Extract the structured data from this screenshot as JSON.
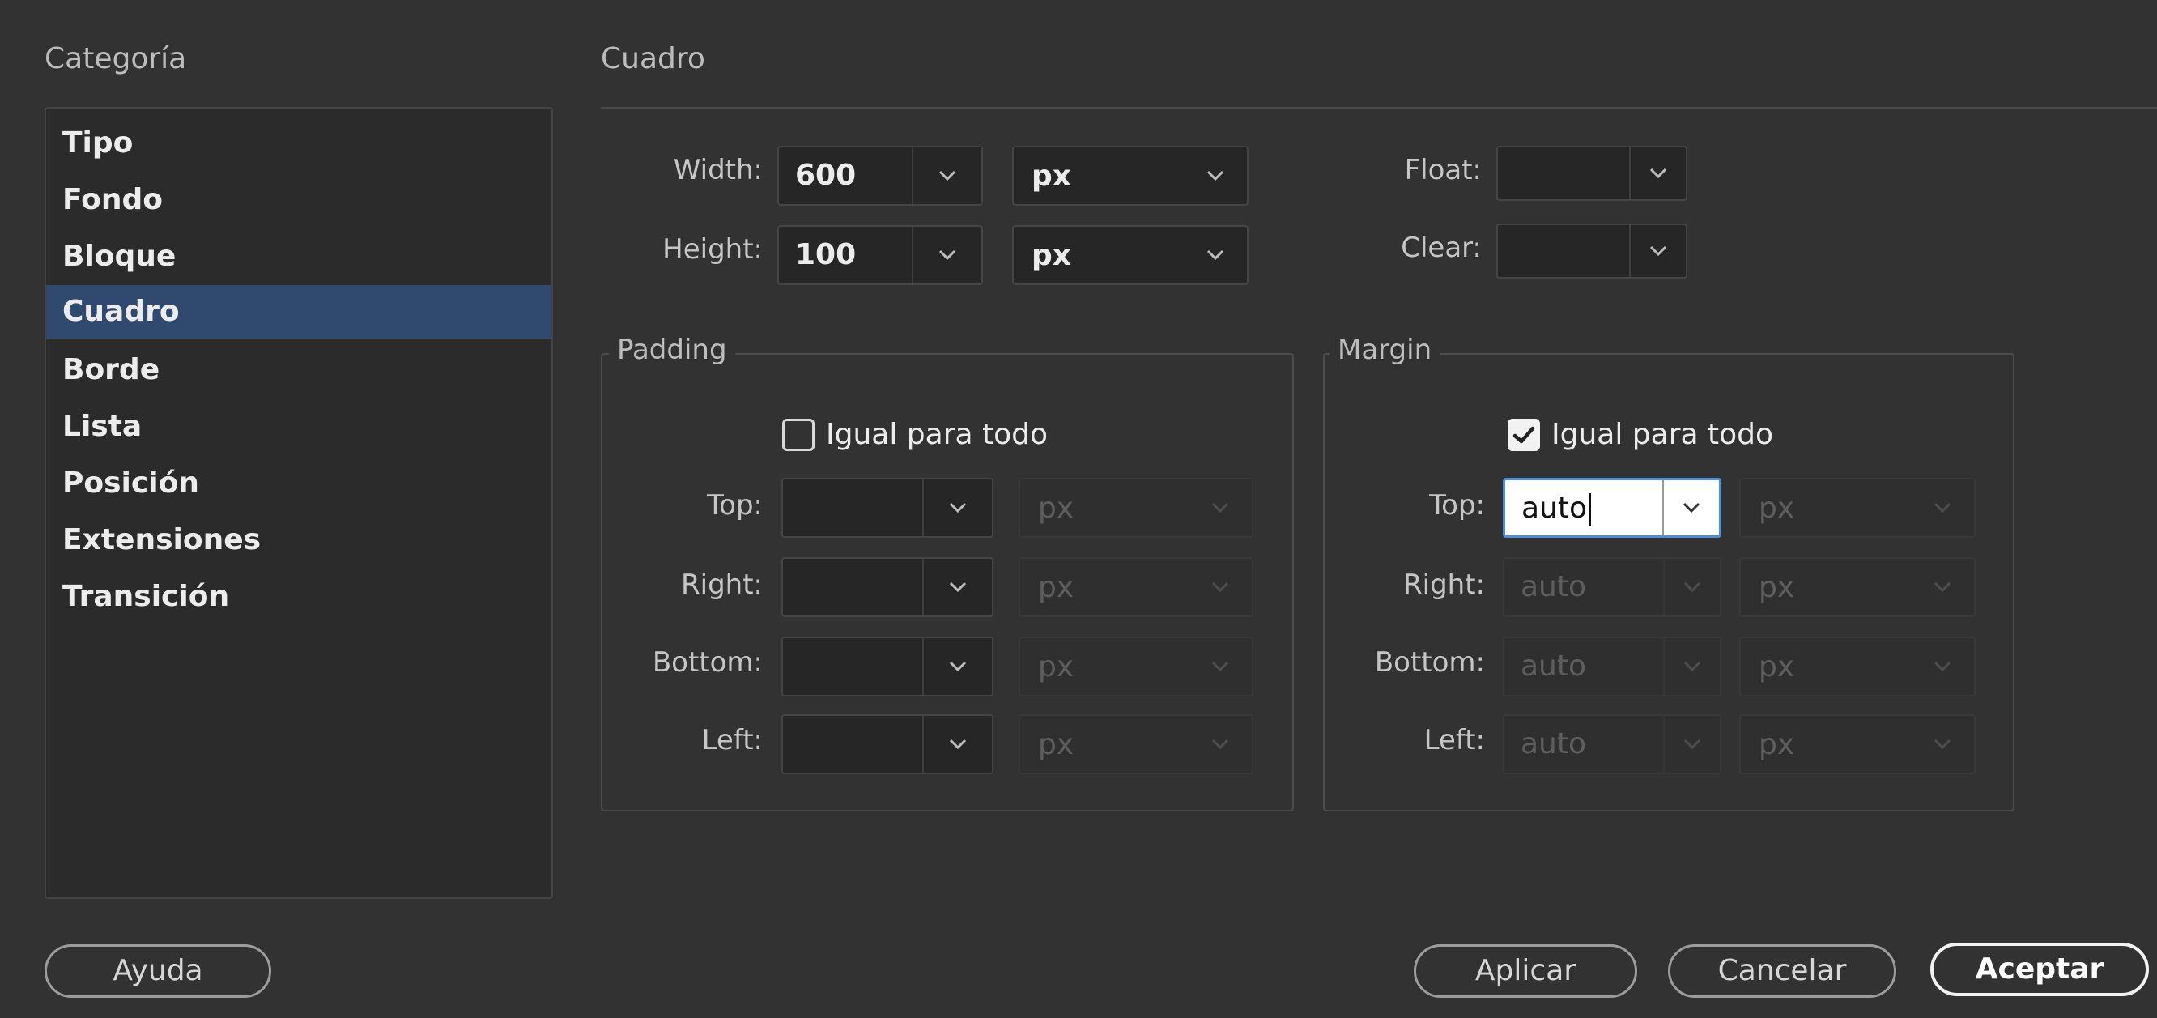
{
  "category": {
    "heading": "Categoría",
    "items": [
      "Tipo",
      "Fondo",
      "Bloque",
      "Cuadro",
      "Borde",
      "Lista",
      "Posición",
      "Extensiones",
      "Transición"
    ],
    "selected_index": 3
  },
  "panel": {
    "title": "Cuadro",
    "width": {
      "label": "Width:",
      "value": "600",
      "unit": "px"
    },
    "height": {
      "label": "Height:",
      "value": "100",
      "unit": "px"
    },
    "float": {
      "label": "Float:",
      "value": ""
    },
    "clear": {
      "label": "Clear:",
      "value": ""
    }
  },
  "padding": {
    "title": "Padding",
    "same_for_all": {
      "label": "Igual para todo",
      "checked": false
    },
    "top": {
      "label": "Top:",
      "value": "",
      "unit": "px"
    },
    "right": {
      "label": "Right:",
      "value": "",
      "unit": "px"
    },
    "bottom": {
      "label": "Bottom:",
      "value": "",
      "unit": "px"
    },
    "left": {
      "label": "Left:",
      "value": "",
      "unit": "px"
    }
  },
  "margin": {
    "title": "Margin",
    "same_for_all": {
      "label": "Igual para todo",
      "checked": true
    },
    "top": {
      "label": "Top:",
      "value": "auto",
      "unit": "px"
    },
    "right": {
      "label": "Right:",
      "value": "auto",
      "unit": "px"
    },
    "bottom": {
      "label": "Bottom:",
      "value": "auto",
      "unit": "px"
    },
    "left": {
      "label": "Left:",
      "value": "auto",
      "unit": "px"
    }
  },
  "buttons": {
    "help": "Ayuda",
    "apply": "Aplicar",
    "cancel": "Cancelar",
    "ok": "Aceptar"
  },
  "colors": {
    "background": "#323232",
    "selection": "#2f4a6e",
    "focus": "#4b8fe0"
  }
}
